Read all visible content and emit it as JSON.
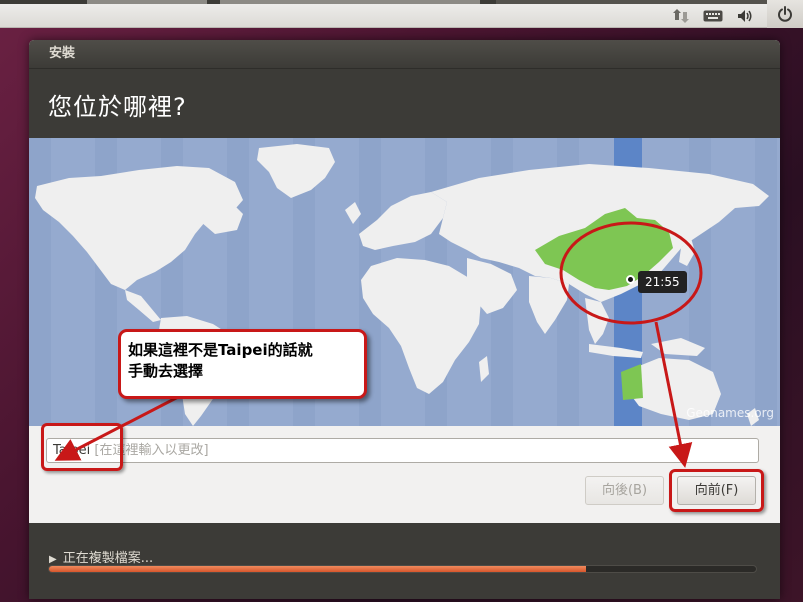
{
  "panel": {
    "tray_icons": [
      "network-icon",
      "keyboard-icon",
      "volume-icon",
      "power-icon"
    ]
  },
  "window": {
    "title": "安裝",
    "heading": "您位於哪裡?"
  },
  "map": {
    "selected_time": "21:55",
    "credit": "Geonames.org",
    "highlighted_region": "China / Taiwan",
    "colors": {
      "ocean": "#95aacf",
      "land": "#efefef",
      "highlight": "#7ec653",
      "timezone_band": "#5c85c7"
    }
  },
  "location": {
    "value": "Taipei",
    "placeholder": "[在這裡輸入以更改]"
  },
  "buttons": {
    "back_label": "向後(B)",
    "next_label": "向前(F)"
  },
  "footer": {
    "status_text": "正在複製檔案...",
    "progress": 0.76
  },
  "annotation": {
    "line1": "如果這裡不是Taipei的話就",
    "line2": "手動去選擇",
    "color": "#c81818"
  }
}
